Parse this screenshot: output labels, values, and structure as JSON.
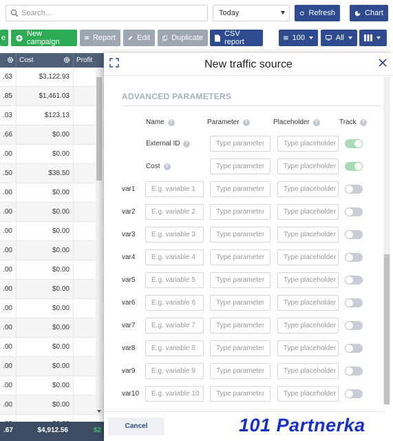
{
  "toolbar": {
    "search_placeholder": "Search...",
    "date_range": "Today",
    "refresh_label": "Refresh",
    "chart_label": "Chart"
  },
  "actions": {
    "e_label": "e",
    "new_campaign_label": "New campaign",
    "report_label": "Report",
    "edit_label": "Edit",
    "duplicate_label": "Duplicate",
    "csv_label": "CSV report",
    "rows_per_page": "100",
    "filter_value": "All"
  },
  "table": {
    "columns": [
      "",
      "Cost",
      "Profit"
    ],
    "rows": [
      {
        "c0": ".63",
        "cost": "$3,122.93"
      },
      {
        "c0": ".85",
        "cost": "$1,461.03"
      },
      {
        "c0": ".03",
        "cost": "$123.13"
      },
      {
        "c0": ".66",
        "cost": "$0.00"
      },
      {
        "c0": ".00",
        "cost": "$0.00"
      },
      {
        "c0": ".50",
        "cost": "$38.50"
      },
      {
        "c0": ".00",
        "cost": "$0.00"
      },
      {
        "c0": ".00",
        "cost": "$0.00"
      },
      {
        "c0": ".00",
        "cost": "$0.00"
      },
      {
        "c0": ".00",
        "cost": "$0.00"
      },
      {
        "c0": ".00",
        "cost": "$0.00"
      },
      {
        "c0": ".00",
        "cost": "$0.00"
      },
      {
        "c0": ".00",
        "cost": "$0.00"
      },
      {
        "c0": ".00",
        "cost": "$0.00"
      },
      {
        "c0": ".00",
        "cost": "$0.00"
      },
      {
        "c0": ".00",
        "cost": "$0.00"
      },
      {
        "c0": ".00",
        "cost": "$0.00"
      },
      {
        "c0": ".00",
        "cost": "$0.00"
      },
      {
        "c0": ".00",
        "cost": "$0.00"
      }
    ],
    "footer": {
      "c0": ".67",
      "cost": "$4,912.56",
      "profit": "$2"
    }
  },
  "modal": {
    "title": "New traffic source",
    "section_title": "ADVANCED PARAMETERS",
    "headers": {
      "name": "Name",
      "parameter": "Parameter",
      "placeholder": "Placeholder",
      "track": "Track"
    },
    "help_glyph": "?",
    "param_placeholder": "Type parameter",
    "placeholder_placeholder": "Type placeholder",
    "fixed_rows": [
      {
        "name": "External ID",
        "track": true
      },
      {
        "name": "Cost",
        "track": true
      }
    ],
    "var_rows": [
      {
        "label": "var1",
        "name_placeholder": "E.g. variable 1",
        "track": false
      },
      {
        "label": "var2",
        "name_placeholder": "E.g. variable 2",
        "track": false
      },
      {
        "label": "var3",
        "name_placeholder": "E.g. variable 3",
        "track": false
      },
      {
        "label": "var4",
        "name_placeholder": "E.g. variable 4",
        "track": false
      },
      {
        "label": "var5",
        "name_placeholder": "E.g. variable 5",
        "track": false
      },
      {
        "label": "var6",
        "name_placeholder": "E.g. variable 6",
        "track": false
      },
      {
        "label": "var7",
        "name_placeholder": "E.g. variable 7",
        "track": false
      },
      {
        "label": "var8",
        "name_placeholder": "E.g. variable 8",
        "track": false
      },
      {
        "label": "var9",
        "name_placeholder": "E.g. variable 9",
        "track": false
      },
      {
        "label": "var10",
        "name_placeholder": "E.g. variable 10",
        "track": false
      }
    ],
    "cancel_label": "Cancel"
  },
  "watermark": "101 Partnerka",
  "colors": {
    "navy": "#2d4b8e",
    "green": "#2eab55",
    "grey_button": "#9da6b3",
    "table_header": "#4f5f77",
    "toggle_on": "#a9dcb6",
    "toggle_off": "#c9ced6",
    "watermark": "#1630c8"
  }
}
